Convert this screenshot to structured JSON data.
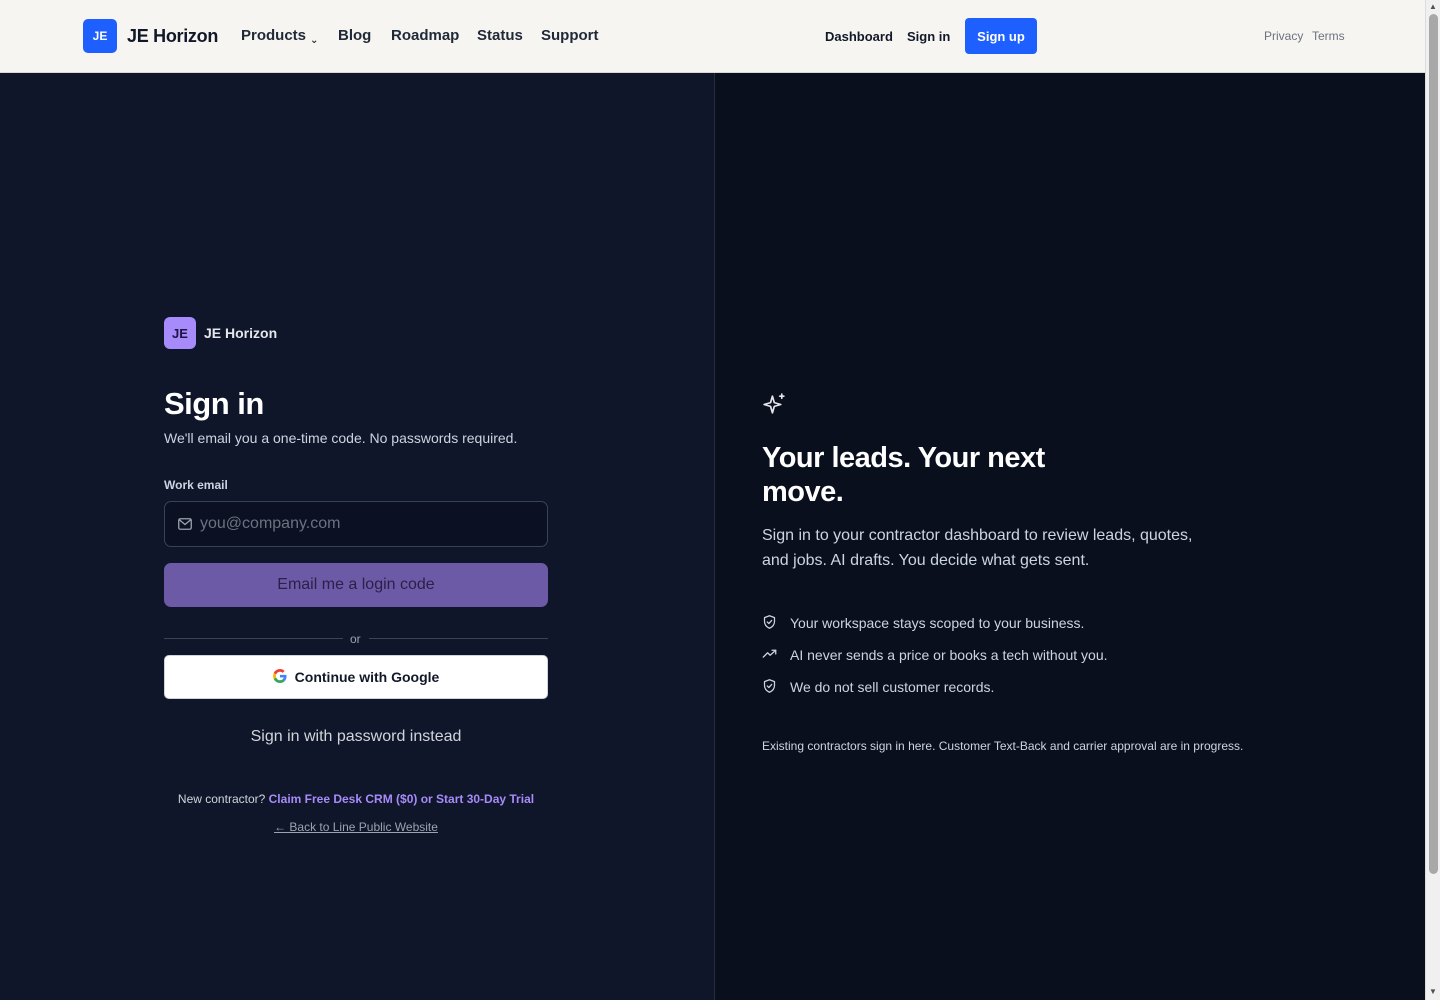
{
  "nav": {
    "logo_badge": "JE",
    "logo_text": "JE Horizon",
    "links": [
      "Products",
      "Blog",
      "Roadmap",
      "Status",
      "Support"
    ],
    "products_chevron": "⌄",
    "dashboard": "Dashboard",
    "sign_in": "Sign in",
    "sign_up": "Sign up",
    "privacy": "Privacy",
    "terms": "Terms"
  },
  "form": {
    "brand_badge": "JE",
    "brand_name": "JE Horizon",
    "title": "Sign in",
    "subtitle": "We'll email you a one-time code. No passwords required.",
    "email_label": "Work email",
    "email_placeholder": "you@company.com",
    "email_value": "",
    "code_button": "Email me a login code",
    "divider_or": "or",
    "google_button": "Continue with Google",
    "password_link": "Sign in with password instead",
    "new_contractor_prefix": "New contractor?",
    "claim_link": "Claim Free Desk CRM ($0) or Start 30-Day Trial",
    "back_link": "← Back to Line Public Website"
  },
  "hero": {
    "title": "Your leads. Your next move.",
    "subtitle": "Sign in to your contractor dashboard to review leads, quotes, and jobs. AI drafts. You decide what gets sent.",
    "features": [
      {
        "icon": "shield-check-icon",
        "text": "Your workspace stays scoped to your business."
      },
      {
        "icon": "trending-up-icon",
        "text": "AI never sends a price or books a tech without you."
      },
      {
        "icon": "shield-check-icon",
        "text": "We do not sell customer records."
      }
    ],
    "footnote": "Existing contractors sign in here. Customer Text-Back and carrier approval are in progress."
  },
  "colors": {
    "brand_blue": "#1e5fff",
    "accent_purple": "#a78bfa",
    "code_button": "#6d5aa6",
    "left_bg": "#0f1629",
    "right_bg": "#0a0f1e"
  }
}
